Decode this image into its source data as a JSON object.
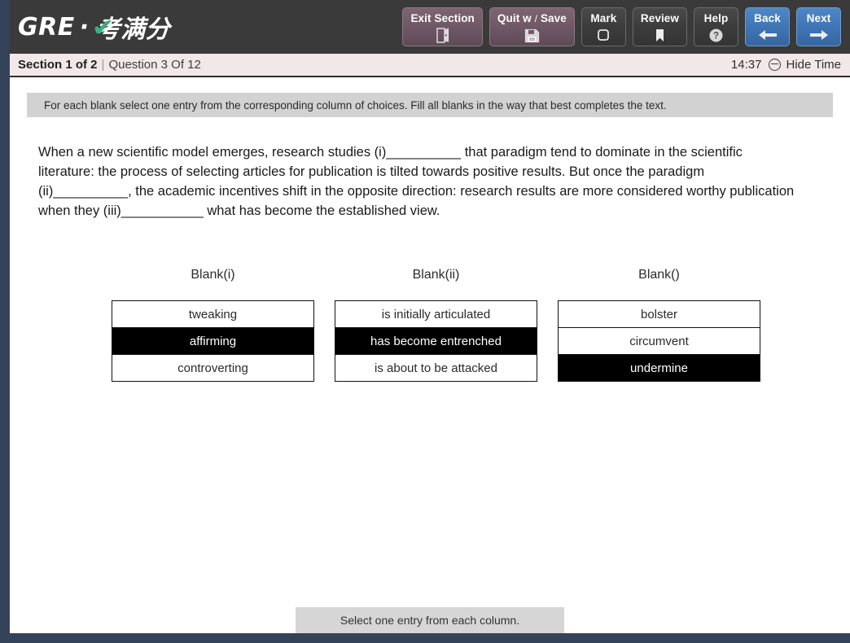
{
  "header": {
    "logo_main": "GRE",
    "logo_dot": "·",
    "logo_cn": "考满分",
    "buttons": [
      {
        "label": "Exit Section",
        "icon": "door-exit-icon",
        "style": "plum"
      },
      {
        "label": "Quit w",
        "label_slash": "/",
        "label_tail": "Save",
        "icon": "floppy-save-icon",
        "style": "plum"
      },
      {
        "label": "Mark",
        "icon": "bookmark-outline-icon",
        "style": "dark"
      },
      {
        "label": "Review",
        "icon": "bookmark-filled-icon",
        "style": "dark"
      },
      {
        "label": "Help",
        "icon": "question-circle-icon",
        "style": "dark"
      },
      {
        "label": "Back",
        "icon": "arrow-left-icon",
        "style": "blue"
      },
      {
        "label": "Next",
        "icon": "arrow-right-icon",
        "style": "blue"
      }
    ]
  },
  "section_bar": {
    "section_label": "Section 1 of 2",
    "separator": "|",
    "question_label": "Question 3 Of 12",
    "timer": "14:37",
    "hide_time_label": "Hide Time",
    "hide_time_icon": "minus-circle-icon"
  },
  "instruction": "For each blank select one entry from the corresponding column of choices. Fill all blanks in the way that best completes the text.",
  "passage": "When a new scientific model emerges, research studies (i)__________ that paradigm tend to dominate in the scientific literature: the process of selecting articles for publication is tilted towards positive results. But once the paradigm (ii)__________, the academic incentives shift in the opposite direction: research results are more considered worthy publication when they (iii)___________ what has become the established view.",
  "columns": [
    {
      "title": "Blank(i)",
      "choices": [
        {
          "text": "tweaking",
          "selected": false
        },
        {
          "text": "affirming",
          "selected": true
        },
        {
          "text": "controverting",
          "selected": false
        }
      ]
    },
    {
      "title": "Blank(ii)",
      "choices": [
        {
          "text": "is initially articulated",
          "selected": false
        },
        {
          "text": "has become entrenched",
          "selected": true
        },
        {
          "text": "is about to be attacked",
          "selected": false
        }
      ]
    },
    {
      "title": "Blank()",
      "choices": [
        {
          "text": "bolster",
          "selected": false
        },
        {
          "text": "circumvent",
          "selected": false
        },
        {
          "text": "undermine",
          "selected": true
        }
      ]
    }
  ],
  "footer_note": "Select one entry from each column.",
  "colors": {
    "frame": "#34425a",
    "header_bg": "#3a3a3a",
    "section_bar_bg": "#f3e8e9",
    "instruction_bg": "#d2d2d2",
    "accent_blue": "#3f74b4",
    "accent_plum": "#6e5765",
    "logo_check_green": "#35b27f",
    "selected_bg": "#000000",
    "footer_note_bg": "#d6d6d6"
  }
}
